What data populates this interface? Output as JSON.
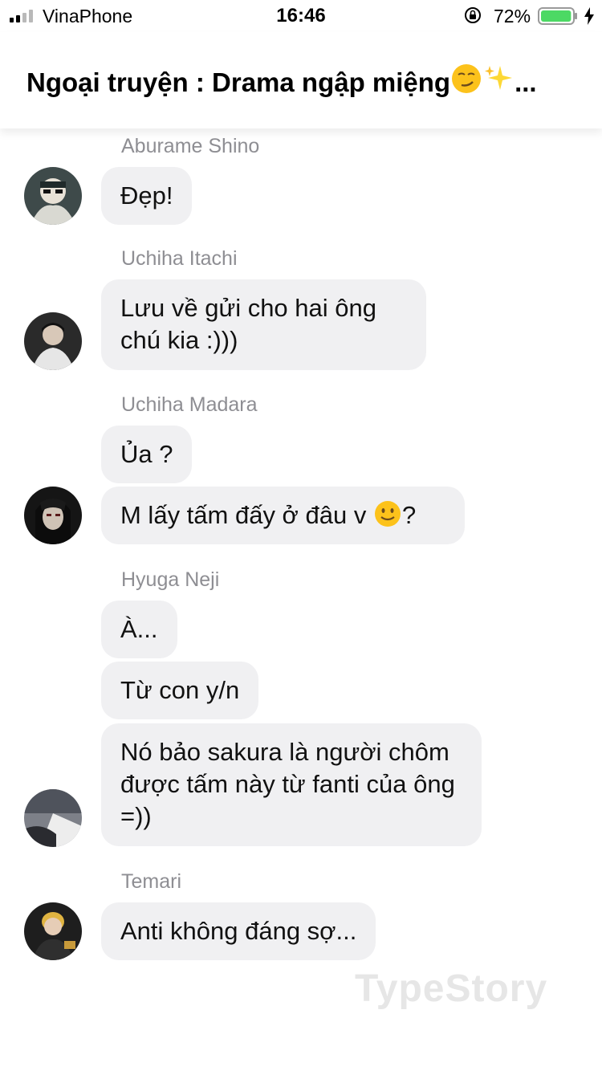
{
  "status": {
    "carrier": "VinaPhone",
    "time": "16:46",
    "battery": "72%",
    "battery_level": 0.72
  },
  "chat": {
    "title": "Ngoại truyện : Drama ngập miệng",
    "title_ellipsis": "..."
  },
  "messages": [
    {
      "sender": "Aburame Shino",
      "texts": [
        "Đẹp!"
      ]
    },
    {
      "sender": "Uchiha Itachi",
      "texts": [
        "Lưu về gửi cho hai ông chú kia :)))"
      ]
    },
    {
      "sender": "Uchiha Madara",
      "texts": [
        "Ủa ?",
        "M lấy tấm đấy ở đâu v",
        "?"
      ]
    },
    {
      "sender": "Hyuga Neji",
      "texts": [
        "À...",
        "Từ con y/n",
        "Nó bảo sakura là người chôm được tấm này từ fanti của ông =))"
      ]
    },
    {
      "sender": "Temari",
      "texts": [
        "Anti không đáng sợ..."
      ]
    }
  ],
  "watermark": "TypeStory",
  "colors": {
    "bubble": "#f0f0f2",
    "sender": "#8e8e93",
    "battery_green": "#4cd964"
  }
}
